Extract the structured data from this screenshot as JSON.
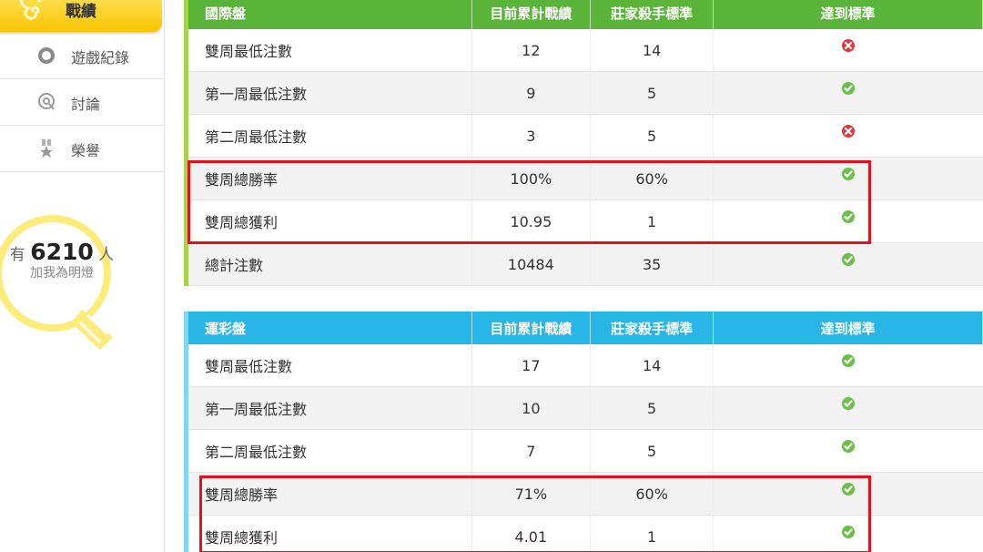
{
  "sidebar": {
    "active": {
      "label": "戰績",
      "icon": "spiral-icon"
    },
    "items": [
      {
        "label": "遊戲紀錄",
        "icon": "circle-icon"
      },
      {
        "label": "討論",
        "icon": "chat-icon"
      },
      {
        "label": "榮譽",
        "icon": "medal-icon"
      }
    ],
    "bulb": {
      "prefix": "有",
      "count": "6210",
      "suffix": "人",
      "line2": "加我為明燈",
      "icon": "lightbulb-icon"
    }
  },
  "tables": [
    {
      "header": [
        "國際盤",
        "目前累計戰績",
        "莊家殺手標準",
        "達到標準"
      ],
      "rows": [
        {
          "name": "雙周最低注數",
          "current": "12",
          "standard": "14",
          "status": "fail"
        },
        {
          "name": "第一周最低注數",
          "current": "9",
          "standard": "5",
          "status": "pass"
        },
        {
          "name": "第二周最低注數",
          "current": "3",
          "standard": "5",
          "status": "fail"
        },
        {
          "name": "雙周總勝率",
          "current": "100%",
          "standard": "60%",
          "status": "pass"
        },
        {
          "name": "雙周總獲利",
          "current": "10.95",
          "standard": "1",
          "status": "pass"
        },
        {
          "name": "總計注數",
          "current": "10484",
          "standard": "35",
          "status": "pass"
        }
      ]
    },
    {
      "header": [
        "運彩盤",
        "目前累計戰績",
        "莊家殺手標準",
        "達到標準"
      ],
      "rows": [
        {
          "name": "雙周最低注數",
          "current": "17",
          "standard": "14",
          "status": "pass"
        },
        {
          "name": "第一周最低注數",
          "current": "10",
          "standard": "5",
          "status": "pass"
        },
        {
          "name": "第二周最低注數",
          "current": "7",
          "standard": "5",
          "status": "pass"
        },
        {
          "name": "雙周總勝率",
          "current": "71%",
          "standard": "60%",
          "status": "pass"
        },
        {
          "name": "雙周總獲利",
          "current": "4.01",
          "standard": "1",
          "status": "pass"
        }
      ]
    }
  ],
  "colors": {
    "table1_header": "#5ab43a",
    "table2_header": "#27b6e6",
    "pass_icon": "#6cbf4a",
    "fail_icon": "#e8353b",
    "highlight": "#e3111b",
    "active_tab": "#f9c400"
  }
}
